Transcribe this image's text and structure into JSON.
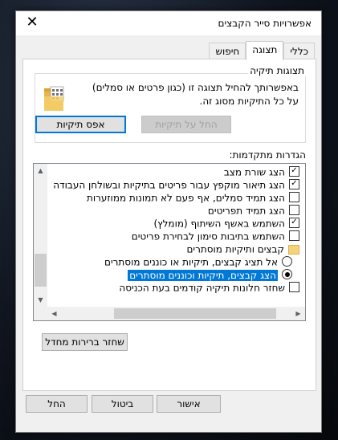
{
  "dialog": {
    "title": "אפשרויות סייר הקבצים",
    "close_glyph": "✕"
  },
  "tabs": [
    {
      "label": "כללי"
    },
    {
      "label": "תצוגה"
    },
    {
      "label": "חיפוש"
    }
  ],
  "folder_views": {
    "legend": "תצוגות תיקיה",
    "description": "באפשרותך להחיל תצוגה זו (כגון פרטים או סמלים) על כל התיקיות מסוג זה.",
    "apply_button": "החל על תיקיות",
    "reset_button": "אפס תיקיות"
  },
  "advanced": {
    "label": "הגדרות מתקדמות:",
    "items": [
      {
        "type": "checkbox",
        "checked": true,
        "text": "הצג שורת מצב"
      },
      {
        "type": "checkbox",
        "checked": true,
        "text": "הצג תיאור מוקפץ עבור פריטים בתיקיות ובשולחן העבודה"
      },
      {
        "type": "checkbox",
        "checked": false,
        "text": "הצג תמיד סמלים, אף פעם לא תמונות ממוזערות"
      },
      {
        "type": "checkbox",
        "checked": false,
        "text": "הצג תמיד תפריטים"
      },
      {
        "type": "checkbox",
        "checked": true,
        "text": "השתמש באשף השיתוף (מומלץ)"
      },
      {
        "type": "checkbox",
        "checked": false,
        "text": "השתמש בתיבות סימון לבחירת פריטים"
      },
      {
        "type": "folder",
        "text": "קבצים ותיקיות מוסתרים"
      },
      {
        "type": "radio",
        "checked": false,
        "text": "אל תציג קבצים, תיקיות או כוננים מוסתרים"
      },
      {
        "type": "radio",
        "checked": true,
        "selected": true,
        "text": "הצג קבצים, תיקיות וכוננים מוסתרים"
      },
      {
        "type": "checkbox",
        "checked": false,
        "text": "שחזר חלונות תיקיה קודמים בעת הכניסה"
      }
    ],
    "restore_defaults_button": "שחזר ברירות מחדל"
  },
  "footer": {
    "ok_button": "אישור",
    "cancel_button": "ביטול",
    "apply_button": "החל"
  }
}
